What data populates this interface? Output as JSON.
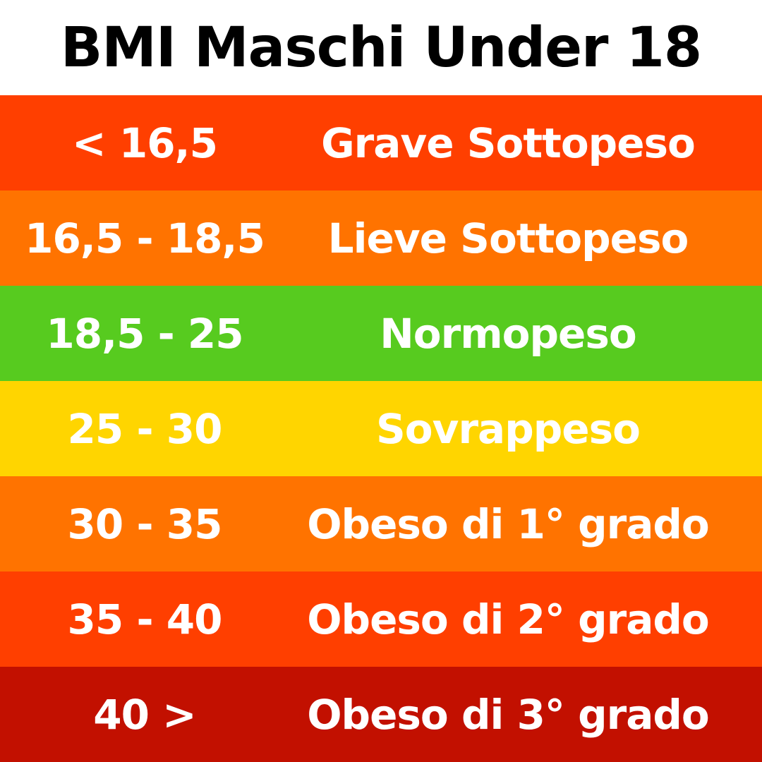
{
  "title": "BMI Maschi Under 18",
  "rows": [
    {
      "range": "< 16,5",
      "label": "Grave Sottopeso",
      "color": "#FF3F00"
    },
    {
      "range": "16,5 - 18,5",
      "label": "Lieve Sottopeso",
      "color": "#FF7300"
    },
    {
      "range": "18,5 - 25",
      "label": "Normopeso",
      "color": "#57CB1F"
    },
    {
      "range": "25 - 30",
      "label": "Sovrappeso",
      "color": "#FFD500"
    },
    {
      "range": "30 - 35",
      "label": "Obeso di 1° grado",
      "color": "#FF7300"
    },
    {
      "range": "35 - 40",
      "label": "Obeso di 2° grado",
      "color": "#FF3F00"
    },
    {
      "range": "40 >",
      "label": "Obeso di 3° grado",
      "color": "#C21000"
    }
  ]
}
